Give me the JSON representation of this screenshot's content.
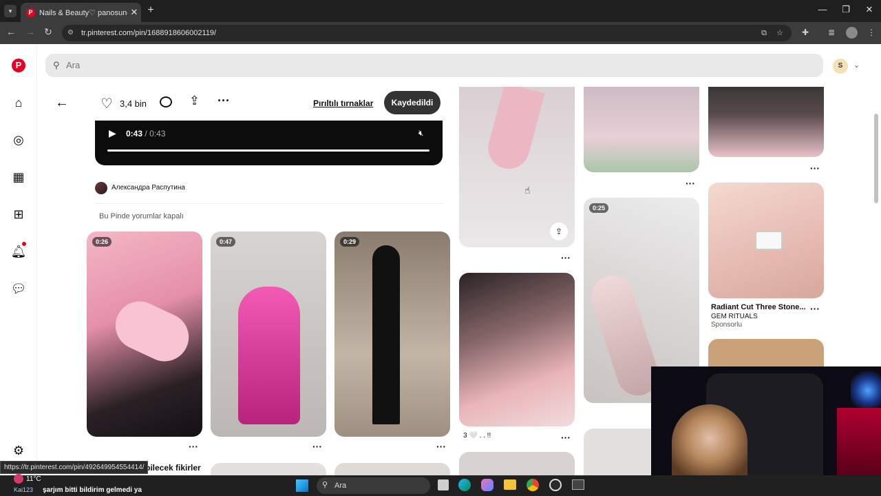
{
  "browser": {
    "tab_title": "Nails & Beauty♡ panosundaki F",
    "url": "tr.pinterest.com/pin/1688918606002119/",
    "status_url": "https://tr.pinterest.com/pin/492649954554414/"
  },
  "search": {
    "placeholder": "Ara"
  },
  "avatar_letter": "S",
  "pin": {
    "likes": "3,4 bin",
    "board_link": "Pırıltılı tırnaklar",
    "save_label": "Kaydedildi",
    "time_current": "0:43",
    "time_sep": "/",
    "time_total": "0:43",
    "author": "Александра Распутина",
    "comments_note": "Bu Pinde yorumlar kapalı",
    "more_title": "debilecek fikirler"
  },
  "durations": {
    "t1": "0:26",
    "t2": "0:47",
    "t3": "0:29",
    "t4": "0:25"
  },
  "ad": {
    "title": "Radiant Cut Three Stone...",
    "brand": "GEM RITUALS",
    "sponsored": "Sponsorlu"
  },
  "pin_caption": "3 🤍 . . !!",
  "taskbar": {
    "temp": "11°C",
    "search": "Ara",
    "notification": "şarjım bitti bildirim gelmedi ya",
    "notification_user": "Kai123"
  },
  "colors": {
    "pinterest_red": "#e60023",
    "save_bg": "#333333"
  }
}
